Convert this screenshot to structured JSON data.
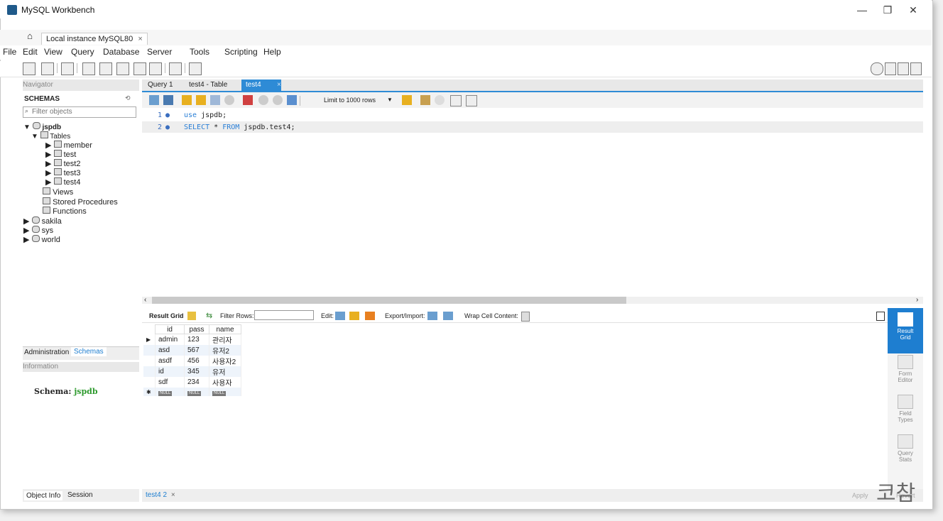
{
  "window": {
    "title": "MySQL Workbench",
    "minimize": "—",
    "restore": "❐",
    "close": "✕"
  },
  "tabs": {
    "home": "⌂",
    "connection": "Local instance MySQL80",
    "close": "×"
  },
  "menu": [
    "File",
    "Edit",
    "View",
    "Query",
    "Database",
    "Server",
    "Tools",
    "Scripting",
    "Help"
  ],
  "navigator": {
    "header": "Navigator",
    "schemas_label": "SCHEMAS",
    "filter_placeholder": "Filter objects",
    "tree": {
      "jspdb": "jspdb",
      "tables": "Tables",
      "table_items": [
        "member",
        "test",
        "test2",
        "test3",
        "test4"
      ],
      "views": "Views",
      "procedures": "Stored Procedures",
      "functions": "Functions",
      "others": [
        "sakila",
        "sys",
        "world"
      ]
    }
  },
  "admin_tabs": {
    "admin": "Administration",
    "schemas": "Schemas"
  },
  "information": {
    "header": "Information",
    "schema_label": "Schema:",
    "schema_value": "jspdb"
  },
  "object_tabs": {
    "info": "Object Info",
    "session": "Session"
  },
  "query_tabs": [
    "Query 1",
    "test4 - Table",
    "test4"
  ],
  "query_tab_close": "×",
  "editor": {
    "limit_label": "Limit to 1000 rows",
    "lines": [
      {
        "num": "1",
        "kw": "use",
        "rest": " jspdb;"
      },
      {
        "num": "2",
        "kw": "SELECT",
        "mid": " * ",
        "kw2": "FROM",
        "rest": " jspdb.test4;"
      }
    ]
  },
  "result": {
    "grid_label": "Result Grid",
    "filter_label": "Filter Rows:",
    "edit_label": "Edit:",
    "export_label": "Export/Import:",
    "wrap_label": "Wrap Cell Content:",
    "columns": [
      "id",
      "pass",
      "name"
    ],
    "rows": [
      [
        "admin",
        "123",
        "관리자"
      ],
      [
        "asd",
        "567",
        "유저2"
      ],
      [
        "asdf",
        "456",
        "사용자2"
      ],
      [
        "id",
        "345",
        "유저"
      ],
      [
        "sdf",
        "234",
        "사용자"
      ]
    ],
    "null_text": "NULL"
  },
  "side_panel": [
    {
      "label1": "Result",
      "label2": "Grid"
    },
    {
      "label1": "Form",
      "label2": "Editor"
    },
    {
      "label1": "Field",
      "label2": "Types"
    },
    {
      "label1": "Query",
      "label2": "Stats"
    }
  ],
  "bottom": {
    "result_tab": "test4 2",
    "apply": "Apply",
    "revert": "Revert",
    "watermark": "코참"
  }
}
